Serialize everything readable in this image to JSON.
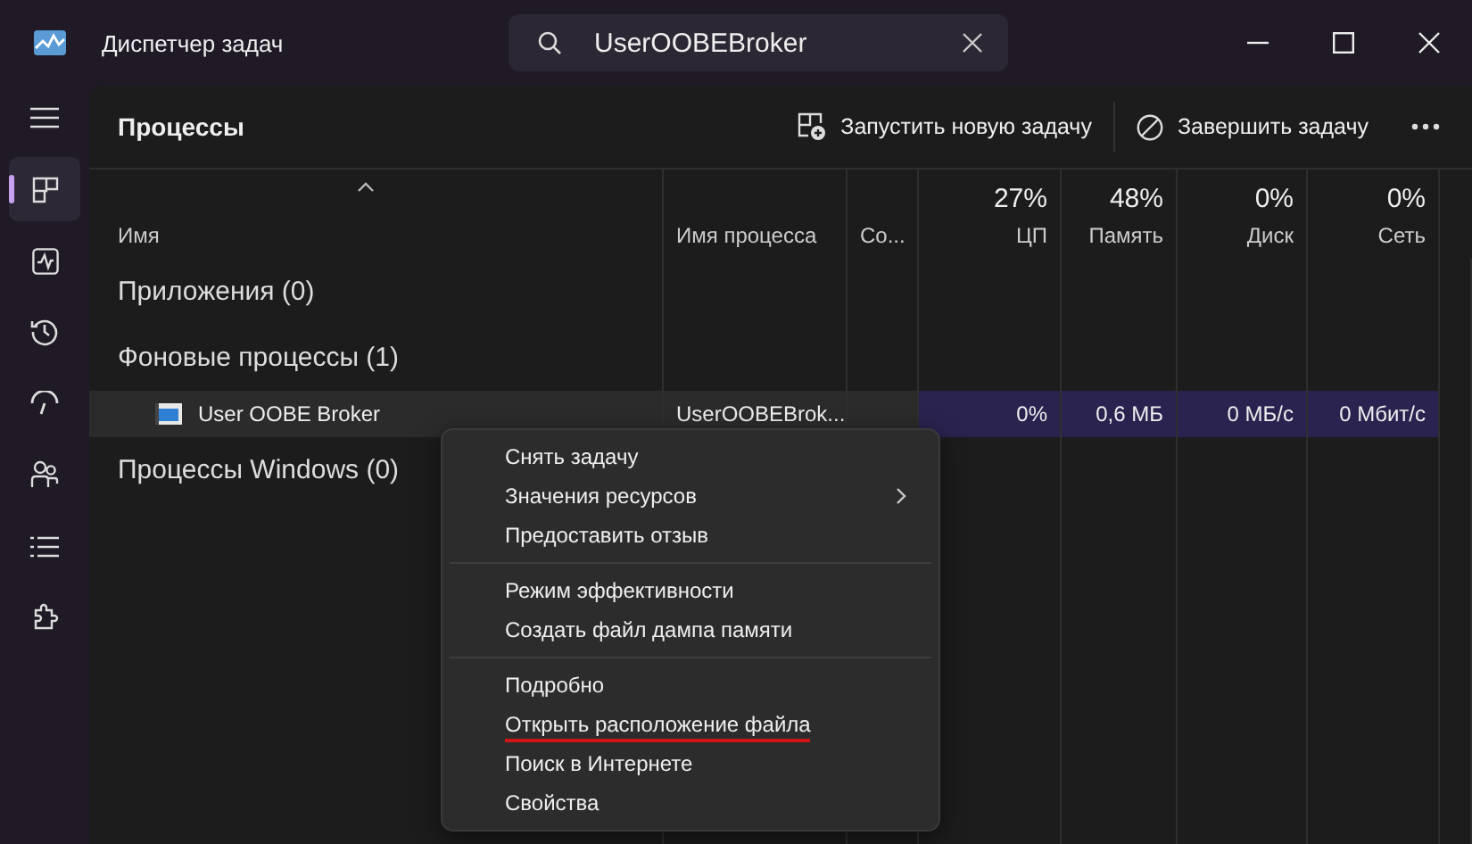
{
  "window": {
    "title": "Диспетчер задач"
  },
  "search": {
    "value": "UserOOBEBroker"
  },
  "sidebar": {
    "items": [
      {
        "kind": "menu",
        "selected": false
      },
      {
        "kind": "processes",
        "selected": true
      },
      {
        "kind": "performance",
        "selected": false
      },
      {
        "kind": "history",
        "selected": false
      },
      {
        "kind": "startup",
        "selected": false
      },
      {
        "kind": "users",
        "selected": false
      },
      {
        "kind": "details",
        "selected": false
      },
      {
        "kind": "services",
        "selected": false
      }
    ]
  },
  "page": {
    "title": "Процессы",
    "actions": [
      {
        "kind": "run",
        "label": "Запустить новую задачу"
      },
      {
        "kind": "end",
        "label": "Завершить задачу"
      }
    ]
  },
  "table": {
    "columns": [
      {
        "label": "Имя",
        "sorted": true
      },
      {
        "label": "Имя процесса",
        "sorted": false
      },
      {
        "label": "Со...",
        "sorted": false
      },
      {
        "label": "ЦП",
        "usage": "27%",
        "sorted": false
      },
      {
        "label": "Память",
        "usage": "48%",
        "sorted": false
      },
      {
        "label": "Диск",
        "usage": "0%",
        "sorted": false
      },
      {
        "label": "Сеть",
        "usage": "0%",
        "sorted": false
      }
    ],
    "rows": [
      {
        "kind": "group",
        "name": "Приложения (0)"
      },
      {
        "kind": "group",
        "name": "Фоновые процессы (1)"
      },
      {
        "kind": "process",
        "name": "User OOBE Broker",
        "cells": [
          "UserOOBEBrok...",
          "",
          "0%",
          "0,6 МБ",
          "0 МБ/с",
          "0 Мбит/с"
        ]
      },
      {
        "kind": "group",
        "name": "Процессы Windows (0)"
      }
    ]
  },
  "context_menu": {
    "sections": [
      [
        {
          "label": "Снять задачу",
          "submenu": false,
          "underlined": false
        },
        {
          "label": "Значения ресурсов",
          "submenu": true,
          "underlined": false
        },
        {
          "label": "Предоставить отзыв",
          "submenu": false,
          "underlined": false
        }
      ],
      [
        {
          "label": "Режим эффективности",
          "submenu": false,
          "underlined": false
        },
        {
          "label": "Создать файл дампа памяти",
          "submenu": false,
          "underlined": false
        }
      ],
      [
        {
          "label": "Подробно",
          "submenu": false,
          "underlined": false
        },
        {
          "label": "Открыть расположение файла",
          "submenu": false,
          "underlined": true
        },
        {
          "label": "Поиск в Интернете",
          "submenu": false,
          "underlined": false
        },
        {
          "label": "Свойства",
          "submenu": false,
          "underlined": false
        }
      ]
    ]
  }
}
